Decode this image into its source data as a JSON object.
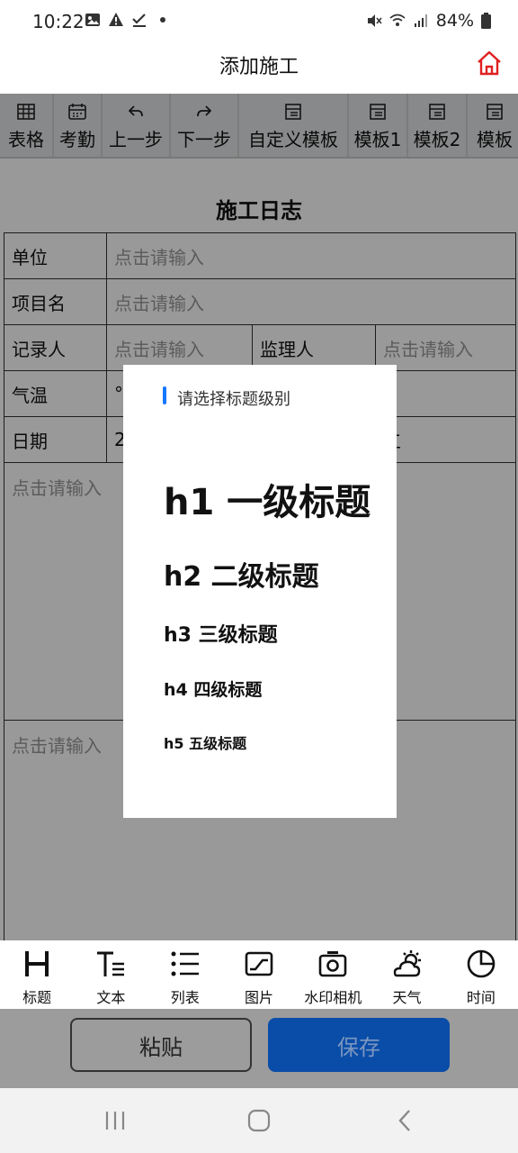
{
  "status_bar": {
    "time": "10:22",
    "battery": "84%"
  },
  "header": {
    "title": "添加施工"
  },
  "toolbar": {
    "items": [
      {
        "label": "表格",
        "icon": "table-icon"
      },
      {
        "label": "考勤",
        "icon": "calendar-icon"
      },
      {
        "label": "上一步",
        "icon": "undo-icon"
      },
      {
        "label": "下一步",
        "icon": "redo-icon"
      },
      {
        "label": "自定义模板",
        "icon": "template-icon"
      },
      {
        "label": "模板1",
        "icon": "template-icon"
      },
      {
        "label": "模板2",
        "icon": "template-icon"
      },
      {
        "label": "模板",
        "icon": "template-icon"
      }
    ]
  },
  "document": {
    "title": "施工日志",
    "unit_label": "单位",
    "project_label": "项目名",
    "recorder_label": "记录人",
    "supervisor_label": "监理人",
    "temp_label": "气温",
    "temp_value": "°C",
    "date_label": "日期",
    "date_value": "2",
    "date_right": "工",
    "placeholder": "点击请输入"
  },
  "modal": {
    "title": "请选择标题级别",
    "options": [
      "h1 一级标题",
      "h2 二级标题",
      "h3 三级标题",
      "h4 四级标题",
      "h5 五级标题"
    ]
  },
  "bottom_toolbar": {
    "items": [
      {
        "label": "标题",
        "icon": "heading-icon"
      },
      {
        "label": "文本",
        "icon": "text-icon"
      },
      {
        "label": "列表",
        "icon": "list-icon"
      },
      {
        "label": "图片",
        "icon": "image-icon"
      },
      {
        "label": "水印相机",
        "icon": "camera-icon"
      },
      {
        "label": "天气",
        "icon": "weather-icon"
      },
      {
        "label": "时间",
        "icon": "clock-icon"
      }
    ]
  },
  "actions": {
    "paste": "粘贴",
    "save": "保存"
  },
  "colors": {
    "accent": "#1677ff",
    "save_button": "#0a4da8",
    "home_icon": "#e02020"
  }
}
